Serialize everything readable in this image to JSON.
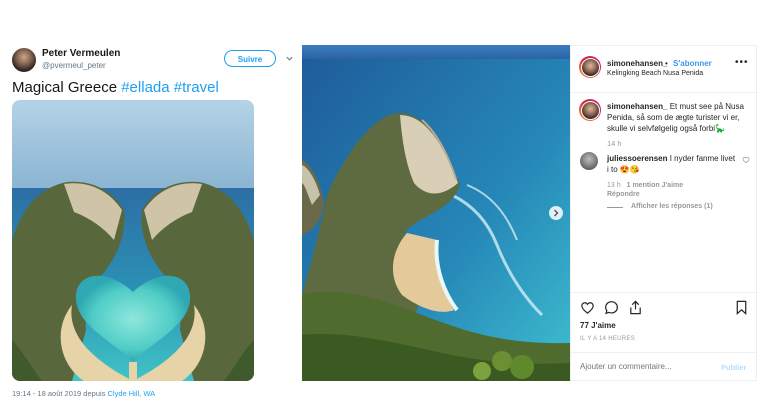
{
  "tweet": {
    "author_name": "Peter Vermeulen",
    "author_handle": "@pvermeul_peter",
    "follow_label": "Suivre",
    "text_plain": "Magical Greece ",
    "hashtag1": "#ellada",
    "hashtag2": "#travel",
    "timestamp": "19:14 - 18 août 2019 depuis ",
    "location": "Clyde Hill, WA",
    "colors": {
      "accent": "#1da1f2"
    }
  },
  "instagram": {
    "username": "simonehansen_",
    "dot": "•",
    "follow_label": "S'abonner",
    "location": "Kelingking Beach Nusa Penida",
    "more_icon": "•••",
    "caption_user": "simonehansen_",
    "caption_text": " Et must see på Nusa Penida, så som de ægte turister vi er, skulle vi selvfølgelig også forbi🦕",
    "caption_time": "14 h",
    "comment_user": "juliessoerensen",
    "comment_text": " I nyder fanme livet i to 😍😘",
    "comment_time": "13 h",
    "comment_likes": "1 mention J'aime",
    "reply_label": "Répondre",
    "view_replies": "Afficher les réponses (1)",
    "likes": "77 J'aime",
    "date": "IL Y A 14 HEURES",
    "comment_placeholder": "Ajouter un commentaire...",
    "post_label": "Publier",
    "icons": [
      "heart-icon",
      "comment-icon",
      "share-icon",
      "bookmark-icon",
      "chevron-right-icon"
    ],
    "colors": {
      "link": "#3897f0",
      "text": "#262626",
      "muted": "#999999"
    }
  }
}
